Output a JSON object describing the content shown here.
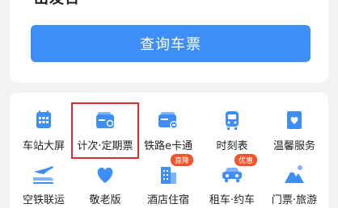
{
  "top": {
    "partial_text": "出发日",
    "query_button": "查询车票"
  },
  "services": [
    {
      "label": "车站大屏",
      "icon": "calendar-grid-icon"
    },
    {
      "label": "计次·定期票",
      "icon": "ticket-wallet-icon"
    },
    {
      "label": "铁路e卡通",
      "icon": "railway-card-icon"
    },
    {
      "label": "时刻表",
      "icon": "train-icon"
    },
    {
      "label": "温馨服务",
      "icon": "heart-document-icon"
    },
    {
      "label": "空铁联运",
      "icon": "plane-train-icon"
    },
    {
      "label": "敬老版",
      "icon": "heart-icon"
    },
    {
      "label": "酒店住宿",
      "icon": "hotel-building-icon",
      "badge": "直降"
    },
    {
      "label": "租车·约车",
      "icon": "car-icon",
      "badge": "优惠"
    },
    {
      "label": "门票·旅游",
      "icon": "mountain-icon"
    }
  ],
  "colors": {
    "primary": "#3d8ef6",
    "highlight": "#d62e2e",
    "badge": "#f2542d",
    "background": "#f2f3f5"
  }
}
